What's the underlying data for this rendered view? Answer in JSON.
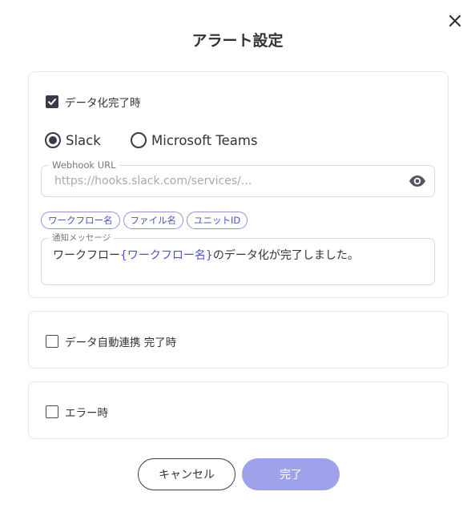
{
  "dialog": {
    "title": "アラート設定",
    "close_icon": "close-icon"
  },
  "section_data_complete": {
    "checkbox_label": "データ化完了時",
    "checked": true,
    "radio_options": [
      {
        "label": "Slack",
        "selected": true
      },
      {
        "label": "Microsoft Teams",
        "selected": false
      }
    ],
    "webhook": {
      "legend": "Webhook URL",
      "placeholder": "https://hooks.slack.com/services/...",
      "visibility_icon": "eye-icon"
    },
    "chips": [
      "ワークフロー名",
      "ファイル名",
      "ユニットID"
    ],
    "message": {
      "legend": "通知メッセージ",
      "prefix": "ワークフロー",
      "variable": "{ワークフロー名}",
      "suffix": "のデータ化が完了しました。"
    }
  },
  "section_auto_link": {
    "checkbox_label": "データ自動連携 完了時",
    "checked": false
  },
  "section_error": {
    "checkbox_label": "エラー時",
    "checked": false
  },
  "footer": {
    "cancel_label": "キャンセル",
    "done_label": "完了"
  },
  "colors": {
    "accent": "#4b52c9",
    "chip_border": "#8e94e6",
    "done_button": "#9ea2ea",
    "dark": "#3a3a48",
    "border": "#e6e6e9"
  }
}
